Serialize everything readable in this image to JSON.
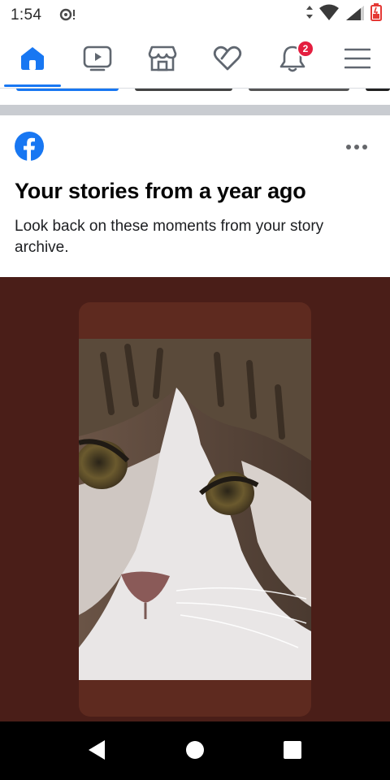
{
  "status_bar": {
    "time": "1:54",
    "notification_icon": "sync-alert-icon",
    "icons": [
      "data-arrows-icon",
      "wifi-icon",
      "cell-signal-icon",
      "battery-icon"
    ]
  },
  "nav": {
    "items": [
      {
        "name": "home",
        "icon": "home-icon",
        "active": true
      },
      {
        "name": "watch",
        "icon": "video-icon"
      },
      {
        "name": "marketplace",
        "icon": "shop-icon"
      },
      {
        "name": "dating",
        "icon": "heart-icon"
      },
      {
        "name": "notifications",
        "icon": "bell-icon",
        "badge": "2"
      },
      {
        "name": "menu",
        "icon": "hamburger-icon"
      }
    ],
    "active_color": "#1877f2",
    "badge_color": "#e41e3f"
  },
  "memory_card": {
    "title": "Your stories from a year ago",
    "description": "Look back on these moments from your story archive.",
    "brand_icon": "facebook-icon",
    "more_icon": "more-horizontal-icon",
    "story_image": "cat-photo"
  },
  "system_nav": {
    "icons": [
      "back-icon",
      "home-circle-icon",
      "recents-square-icon"
    ]
  }
}
